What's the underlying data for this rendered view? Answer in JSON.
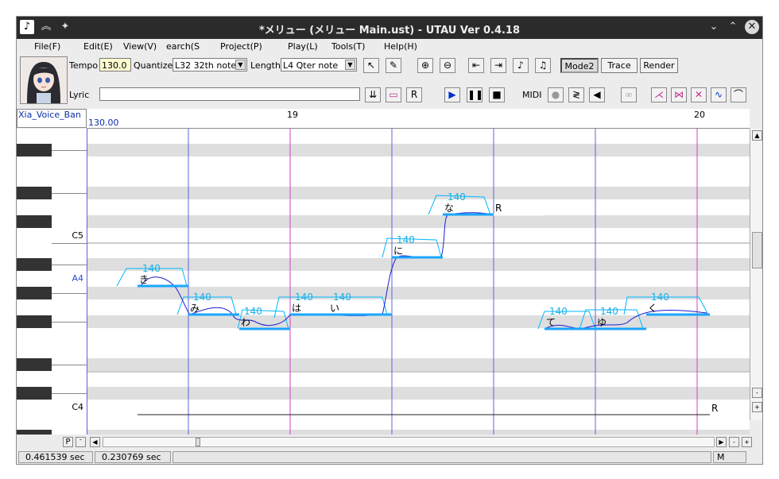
{
  "window": {
    "title": "*メリュー (メリュー Main.ust) - UTAU Ver 0.4.18"
  },
  "menu": [
    "File(F)",
    "Edit(E)",
    "View(V)",
    "earch(S",
    "Project(P)",
    "Play(L)",
    "Tools(T)",
    "Help(H)"
  ],
  "toolbar": {
    "tempo_label": "Tempo",
    "tempo_value": "130.0",
    "quantize_label": "Quantize",
    "quantize_value": "L32 32th note",
    "length_label": "Length",
    "length_value": "L4  Qter note",
    "lyric_label": "Lyric",
    "lyric_value": "",
    "midi_label": "MIDI",
    "mode2_label": "Mode2",
    "trace_label": "Trace",
    "render_label": "Render"
  },
  "track": {
    "name": "Xia_Voice_Ban",
    "tempo": "130.00"
  },
  "ruler": {
    "measures": [
      "19",
      "20"
    ]
  },
  "keys": {
    "c5": "C5",
    "a4": "A4",
    "c4": "C4"
  },
  "notes": [
    {
      "lyric": "き",
      "vel": "140"
    },
    {
      "lyric": "み",
      "vel": "140"
    },
    {
      "lyric": "わ",
      "vel": "140"
    },
    {
      "lyric": "は",
      "vel": "140"
    },
    {
      "lyric": "い",
      "vel": "140"
    },
    {
      "lyric": "に",
      "vel": "140"
    },
    {
      "lyric": "な",
      "vel": "140"
    },
    {
      "lyric": "て",
      "vel": "140"
    },
    {
      "lyric": "ゆ",
      "vel": "140"
    },
    {
      "lyric": "く",
      "vel": "140"
    }
  ],
  "rests": [
    "R",
    "R"
  ],
  "status": {
    "pos1": "0.461539 sec",
    "pos2": "0.230769 sec",
    "mode": "M"
  },
  "hscroll": {
    "p_label": "P"
  },
  "colors": {
    "note": "#00b7ff",
    "pitch": "#1b1bd0",
    "measure_line": "#d040d0",
    "beat_line": "#6060e0",
    "row_gray": "#dedede"
  }
}
